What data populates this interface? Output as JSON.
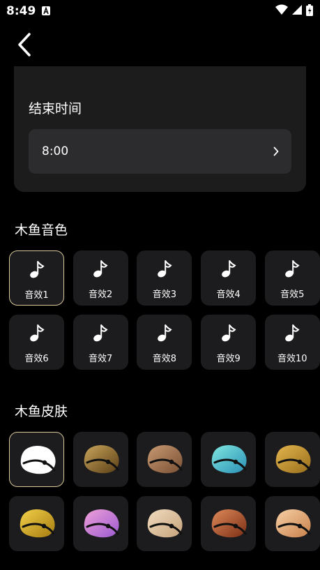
{
  "status_bar": {
    "time": "8:49",
    "app_icon": "a-icon",
    "icons": [
      "wifi-icon",
      "signal-icon",
      "battery-icon"
    ]
  },
  "nav": {
    "back_icon": "chevron-left-icon"
  },
  "end_time": {
    "label": "结束时间",
    "value": "8:00",
    "chevron_icon": "chevron-right-icon"
  },
  "sound_section": {
    "title": "木鱼音色",
    "note_icon": "music-note-icon",
    "items": [
      "音效1",
      "音效2",
      "音效3",
      "音效4",
      "音效5",
      "音效6",
      "音效7",
      "音效8",
      "音效9",
      "音效10"
    ],
    "selected_index": 0
  },
  "skin_section": {
    "title": "木鱼皮肤",
    "selected_index": 0,
    "items": [
      {
        "name": "white-skin",
        "colors": [
          "#ffffff",
          "#ffffff"
        ]
      },
      {
        "name": "bronze-skin",
        "colors": [
          "#c9a45a",
          "#5a3f16"
        ]
      },
      {
        "name": "wood-skin",
        "colors": [
          "#c89a72",
          "#7a5034"
        ]
      },
      {
        "name": "cyan-skin",
        "colors": [
          "#7fe8e0",
          "#2a8fb5"
        ]
      },
      {
        "name": "gold-texture-skin",
        "colors": [
          "#e2b54c",
          "#9a6e1c"
        ]
      },
      {
        "name": "gold-leaf-skin",
        "colors": [
          "#f3d04a",
          "#a47c10"
        ]
      },
      {
        "name": "pink-purple-skin",
        "colors": [
          "#f0a0d8",
          "#9a5ad0"
        ]
      },
      {
        "name": "pale-wood-skin",
        "colors": [
          "#f2dcc0",
          "#c4a27a"
        ]
      },
      {
        "name": "rosewood-skin",
        "colors": [
          "#e08a5a",
          "#7a2e14"
        ]
      },
      {
        "name": "peach-wood-skin",
        "colors": [
          "#f7d0a6",
          "#c8804a"
        ]
      }
    ]
  },
  "accent_color": "#d8c79a"
}
